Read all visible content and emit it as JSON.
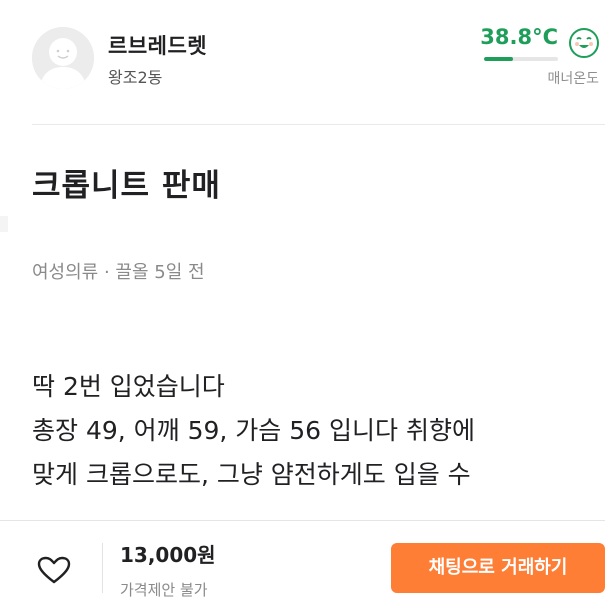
{
  "seller": {
    "name": "르브레드렛",
    "region": "왕조2동",
    "manner_temperature": {
      "value": "38.8°C",
      "label": "매너온도",
      "level_fraction": 0.388,
      "color": "#1f9e5a",
      "icon": "smiling-face-icon"
    },
    "avatar_icon": "default-profile-avatar"
  },
  "article": {
    "title": "크롭니트 판매",
    "meta": "여성의류 · 끌올 5일 전",
    "description_lines": [
      "딱 2번 입었습니다",
      "총장 49, 어깨 59, 가슴 56 입니다 취향에",
      "맞게 크롭으로도, 그냥 얌전하게도 입을 수"
    ]
  },
  "bottom_bar": {
    "like_icon": "heart-outline-icon",
    "price": "13,000원",
    "price_note": "가격제안 불가",
    "chat_button_label": "채팅으로 거래하기",
    "chat_button_color": "#ff7e36"
  }
}
